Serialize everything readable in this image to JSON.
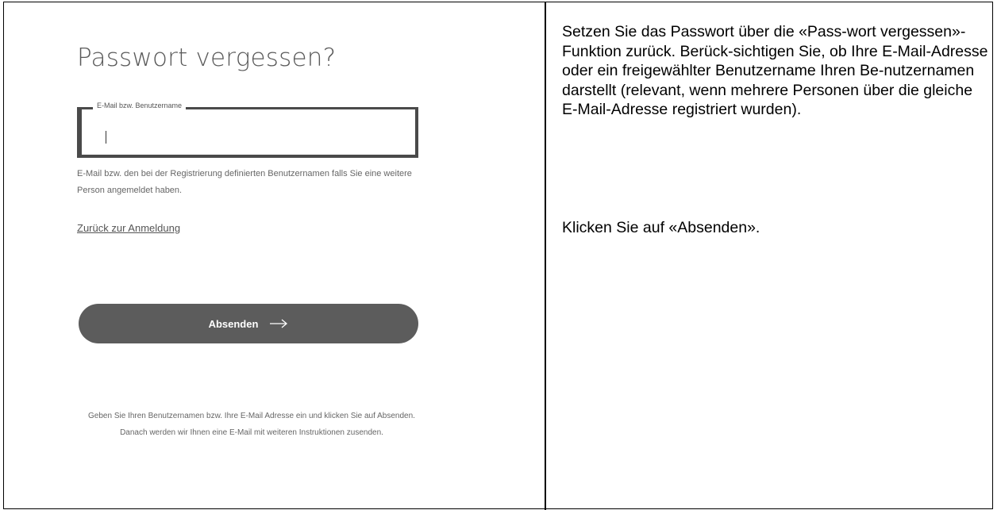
{
  "form": {
    "title": "Passwort vergessen?",
    "field_label": "E-Mail bzw. Benutzername",
    "field_value": "",
    "field_help": "E-Mail bzw. den bei der Registrierung definierten Benutzernamen falls Sie eine weitere Person angemeldet haben.",
    "back_link": "Zurück zur Anmeldung",
    "submit_label": "Absenden",
    "footer_note": "Geben Sie Ihren Benutzernamen bzw. Ihre E-Mail Adresse ein und klicken Sie auf Absenden. Danach werden wir Ihnen eine E-Mail mit weiteren Instruktionen zusenden."
  },
  "instructions": {
    "step_1": "Setzen Sie das Passwort über die «Pass-wort vergessen»- Funktion zurück. Berück-sichtigen Sie, ob Ihre E-Mail-Adresse oder ein freigewählter Benutzername Ihren Be-nutzernamen darstellt (relevant, wenn mehrere Personen über die gleiche E-Mail-Adresse registriert wurden).",
    "step_2": "Klicken Sie auf «Absenden»."
  },
  "colors": {
    "button_bg": "#5c5c5c",
    "text_gray": "#666666",
    "border": "#000000"
  },
  "icons": {
    "submit_arrow": "arrow-right-icon"
  }
}
